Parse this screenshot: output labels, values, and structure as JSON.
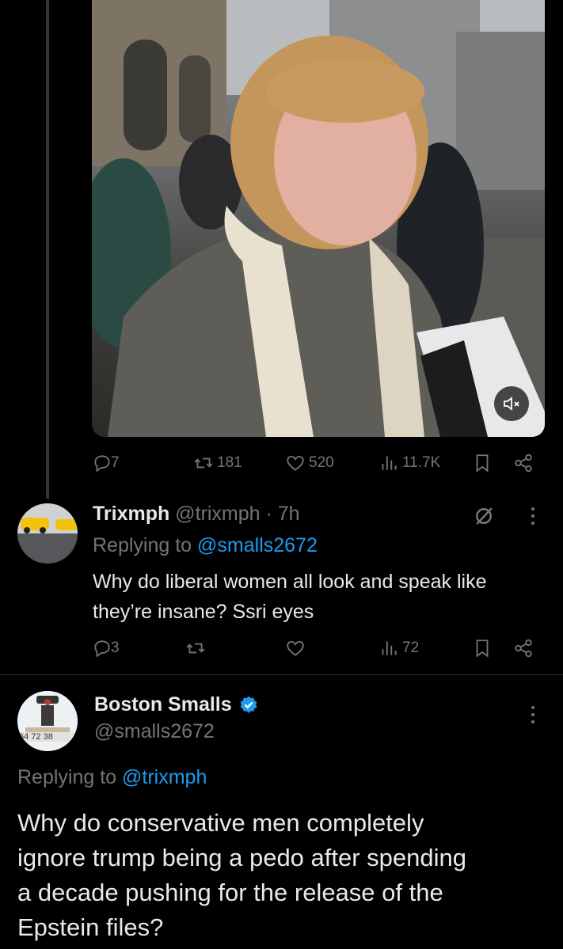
{
  "post1": {
    "stats": {
      "replies": "7",
      "reposts": "181",
      "likes": "520",
      "views": "11.7K"
    }
  },
  "reply1": {
    "name": "Trixmph",
    "handle": "@trixmph",
    "time": "· 7h",
    "replying_prefix": "Replying to",
    "replying_handle": "@smalls2672",
    "text_line1": "Why do liberal women all look and speak like",
    "text_line2": "they’re insane? Ssri eyes",
    "stats": {
      "replies": "3",
      "views": "72"
    }
  },
  "reply2": {
    "name": "Boston Smalls",
    "handle": "@smalls2672",
    "avatar_caption": "64 72 38",
    "replying_prefix": "Replying to",
    "replying_handle": "@trixmph",
    "text_line1": "Why do conservative men completely",
    "text_line2": "ignore trump being a pedo after spending",
    "text_line3": "a decade pushing for the release of the",
    "text_line4": "Epstein files?"
  },
  "colors": {
    "accent": "#1d9bf0",
    "muted": "#71767b",
    "text": "#e7e9ea",
    "bg": "#000000"
  },
  "icons": [
    "reply-icon",
    "repost-icon",
    "like-icon",
    "views-icon",
    "bookmark-icon",
    "share-icon",
    "grok-icon",
    "more-icon",
    "mute-icon",
    "verified-icon"
  ]
}
